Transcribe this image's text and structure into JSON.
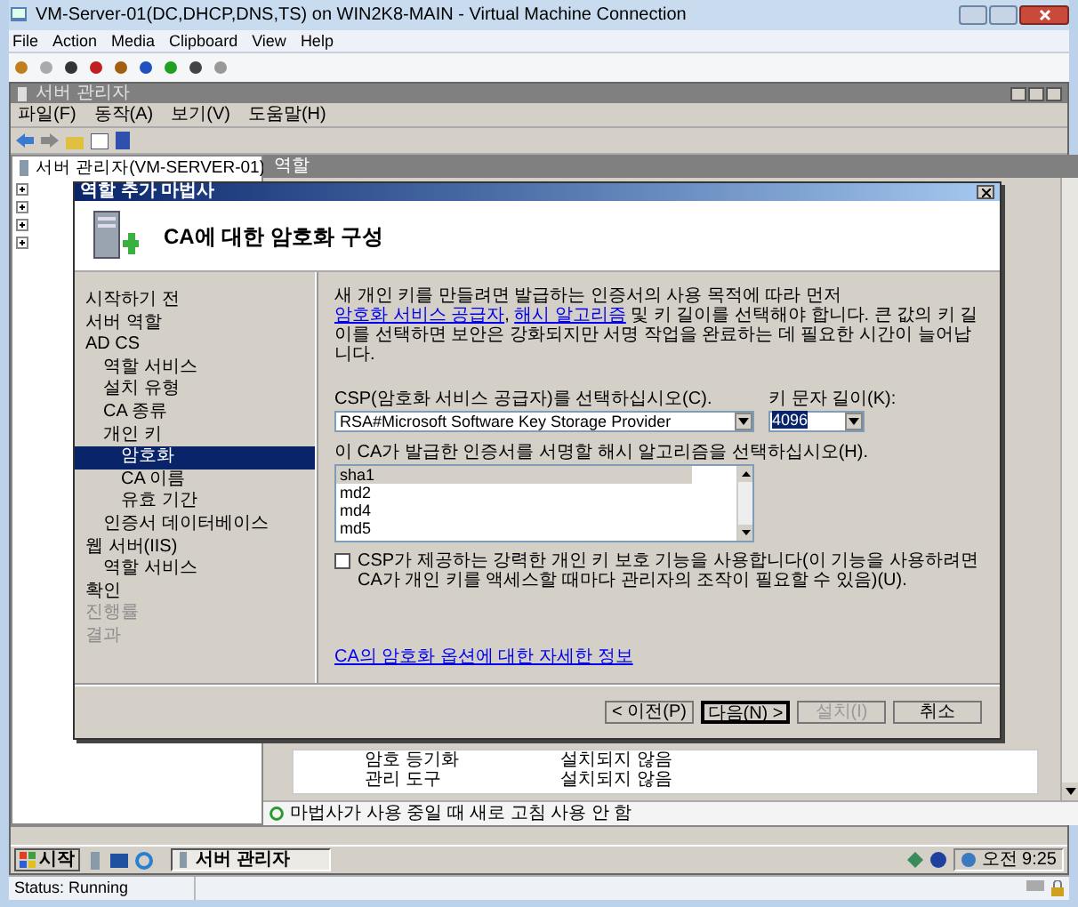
{
  "vm_window": {
    "title": "VM-Server-01(DC,DHCP,DNS,TS) on WIN2K8-MAIN - Virtual Machine Connection",
    "menu": [
      "File",
      "Action",
      "Media",
      "Clipboard",
      "View",
      "Help"
    ],
    "status": "Status: Running"
  },
  "server_manager": {
    "title": "서버 관리자",
    "menu": [
      "파일(F)",
      "동작(A)",
      "보기(V)",
      "도움말(H)"
    ],
    "tree_root": "서버 관리자(VM-SERVER-01)",
    "pane_header": "역할",
    "rows": [
      {
        "name": "암호 등기화",
        "status": "설치되지 않음"
      },
      {
        "name": "관리 도구",
        "status": "설치되지 않음"
      }
    ],
    "refresh_notice": "마법사가 사용 중일 때 새로 고침 사용 안 함"
  },
  "dialog": {
    "title": "역할 추가 마법사",
    "heading": "CA에 대한 암호화 구성",
    "nav": [
      {
        "label": "시작하기 전",
        "selected": false,
        "disabled": false
      },
      {
        "label": "서버 역할",
        "selected": false,
        "disabled": false
      },
      {
        "label": "AD CS",
        "selected": false,
        "disabled": false,
        "children": [
          {
            "label": "역할 서비스",
            "selected": false,
            "disabled": false
          },
          {
            "label": "설치 유형",
            "selected": false,
            "disabled": false
          },
          {
            "label": "CA 종류",
            "selected": false,
            "disabled": false
          },
          {
            "label": "개인 키",
            "selected": false,
            "disabled": false,
            "children": [
              {
                "label": "암호화",
                "selected": true,
                "disabled": false
              },
              {
                "label": "CA 이름",
                "selected": false,
                "disabled": false
              },
              {
                "label": "유효 기간",
                "selected": false,
                "disabled": false
              }
            ]
          },
          {
            "label": "인증서 데이터베이스",
            "selected": false,
            "disabled": false
          }
        ]
      },
      {
        "label": "웹 서버(IIS)",
        "selected": false,
        "disabled": false,
        "children": [
          {
            "label": "역할 서비스",
            "selected": false,
            "disabled": false
          }
        ]
      },
      {
        "label": "확인",
        "selected": false,
        "disabled": false
      },
      {
        "label": "진행률",
        "selected": false,
        "disabled": true
      },
      {
        "label": "결과",
        "selected": false,
        "disabled": true
      }
    ],
    "description": [
      {
        "kind": "text",
        "text": "새 개인 키를 만들려면 발급하는 인증서의 사용 목적에 따라 먼저 "
      },
      {
        "kind": "link",
        "text": "암호화 서비스 공급자"
      },
      {
        "kind": "text",
        "text": ", "
      },
      {
        "kind": "link",
        "text": "해시 알고리즘"
      },
      {
        "kind": "text",
        "text": " 및 키 길이를 선택해야 합니다. 큰 값의 키 길이를 선택하면 보안은 강화되지만 서명 작업을 완료하는 데 필요한 시간이 늘어납니다."
      }
    ],
    "csp_label": "CSP(암호화 서비스 공급자)를 선택하십시오(C).",
    "csp_value": "RSA#Microsoft Software Key Storage Provider",
    "key_label": "키 문자 길이(K):",
    "key_value": "4096",
    "hash_label": "이 CA가 발급한 인증서를 서명할 해시 알고리즘을 선택하십시오(H).",
    "hash_options": [
      {
        "label": "sha1",
        "selected": true
      },
      {
        "label": "md2",
        "selected": false
      },
      {
        "label": "md4",
        "selected": false
      },
      {
        "label": "md5",
        "selected": false
      }
    ],
    "protect": {
      "label": "CSP가 제공하는 강력한 개인 키 보호 기능을 사용합니다(이 기능을 사용하려면 CA가 개인 키를 액세스할 때마다 관리자의 조작이 필요할 수 있음)(U).",
      "checked": false
    },
    "more_link": "CA의 암호화 옵션에 대한 자세한 정보",
    "buttons": [
      {
        "label": "< 이전(P)",
        "disabled": false,
        "default": false
      },
      {
        "label": "다음(N) >",
        "disabled": false,
        "default": true
      },
      {
        "label": "설치(I)",
        "disabled": true,
        "default": false
      },
      {
        "label": "취소",
        "disabled": false,
        "default": false
      }
    ]
  },
  "taskbar": {
    "start": "시작",
    "tasks": [
      {
        "label": "서버 관리자",
        "selected": true
      }
    ],
    "clock": "오전 9:25"
  }
}
